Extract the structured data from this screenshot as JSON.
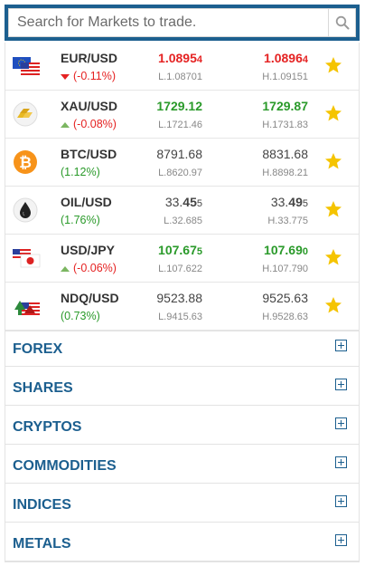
{
  "search": {
    "placeholder": "Search for Markets to trade."
  },
  "colors": {
    "accent": "#1c5f8f",
    "up": "#2a9a2a",
    "down": "#e52222",
    "star": "#f5c400"
  },
  "markets": [
    {
      "symbol": "EUR/USD",
      "icon": "eu-us-flags-icon",
      "change": "(-0.11%)",
      "direction": "down",
      "bid_main": "1.0895",
      "bid_pip": "4",
      "ask_main": "1.0896",
      "ask_pip": "4",
      "low": "L.1.08701",
      "high": "H.1.09151",
      "tone": "red"
    },
    {
      "symbol": "XAU/USD",
      "icon": "gold-icon",
      "change": "(-0.08%)",
      "direction": "up",
      "bid_main": "1729.12",
      "bid_pip": "",
      "ask_main": "1729.87",
      "ask_pip": "",
      "low": "L.1721.46",
      "high": "H.1731.83",
      "tone": "green"
    },
    {
      "symbol": "BTC/USD",
      "icon": "bitcoin-icon",
      "change": "(1.12%)",
      "direction": "none",
      "bid_main": "8791.68",
      "bid_pip": "",
      "ask_main": "8831.68",
      "ask_pip": "",
      "low": "L.8620.97",
      "high": "H.8898.21",
      "tone": "grey"
    },
    {
      "symbol": "OIL/USD",
      "icon": "oil-drop-icon",
      "change": "(1.76%)",
      "direction": "none",
      "bid_main": "33.",
      "bid_bold": "45",
      "bid_pip": "5",
      "ask_main": "33.",
      "ask_bold": "49",
      "ask_pip": "5",
      "low": "L.32.685",
      "high": "H.33.775",
      "tone": "grey"
    },
    {
      "symbol": "USD/JPY",
      "icon": "us-jp-flags-icon",
      "change": "(-0.06%)",
      "direction": "up",
      "bid_main": "107.67",
      "bid_pip": "5",
      "ask_main": "107.69",
      "ask_pip": "0",
      "low": "L.107.622",
      "high": "H.107.790",
      "tone": "green"
    },
    {
      "symbol": "NDQ/USD",
      "icon": "nasdaq-us-icon",
      "change": "(0.73%)",
      "direction": "none",
      "bid_main": "9523.88",
      "bid_pip": "",
      "ask_main": "9525.63",
      "ask_pip": "",
      "low": "L.9415.63",
      "high": "H.9528.63",
      "tone": "grey"
    }
  ],
  "categories": [
    "FOREX",
    "SHARES",
    "CRYPTOS",
    "COMMODITIES",
    "INDICES",
    "METALS"
  ]
}
